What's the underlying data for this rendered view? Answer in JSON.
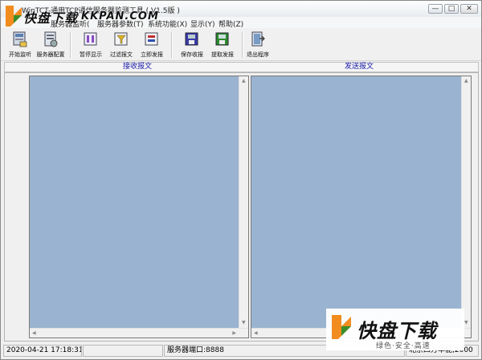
{
  "window": {
    "title": "WinTCT-通用TCP通信服务器监测工具 ( V1.5版 )",
    "controls": {
      "minimize": "—",
      "maximize": "□",
      "close": "✕"
    }
  },
  "watermark_top": {
    "cn": "快盘下载",
    "en": "KKPAN.COM"
  },
  "menu": [
    "服务器监听(",
    "服务器参数(T)",
    "系统功能(X)",
    "显示(Y)",
    "帮助(Z)"
  ],
  "toolbar": [
    {
      "label": "开始监听",
      "icon": "listen-icon"
    },
    {
      "label": "服务器配置",
      "icon": "server-config-icon"
    },
    {
      "label": "暂停显示",
      "icon": "pause-display-icon"
    },
    {
      "label": "过滤报文",
      "icon": "filter-icon"
    },
    {
      "label": "立即发报",
      "icon": "send-now-icon"
    },
    {
      "label": "保存收报",
      "icon": "save-received-icon"
    },
    {
      "label": "提取发报",
      "icon": "extract-send-icon"
    },
    {
      "label": "退出程序",
      "icon": "exit-icon"
    }
  ],
  "panels": {
    "receive_header": "接收报文",
    "send_header": "发送报文"
  },
  "status": {
    "datetime": "2020-04-21 17:18:31",
    "port": "服务器端口:8888",
    "company": "北京四方华能,2000"
  },
  "watermark_bottom": {
    "cn": "快盘下载",
    "slogan": "绿色·安全·高速"
  },
  "colors": {
    "pane_bg": "#9ab3d0",
    "header_text": "#1a1aa8",
    "leaf_orange": "#f28c1e"
  }
}
